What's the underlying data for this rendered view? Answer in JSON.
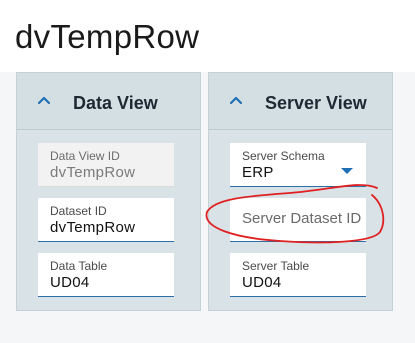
{
  "page": {
    "title": "dvTempRow"
  },
  "left_panel": {
    "title": "Data View",
    "fields": {
      "data_view_id": {
        "label": "Data View ID",
        "value": "dvTempRow"
      },
      "dataset_id": {
        "label": "Dataset ID",
        "value": "dvTempRow"
      },
      "data_table": {
        "label": "Data Table",
        "value": "UD04"
      }
    }
  },
  "right_panel": {
    "title": "Server View",
    "fields": {
      "server_schema": {
        "label": "Server Schema",
        "value": "ERP"
      },
      "server_dataset_id": {
        "placeholder": "Server Dataset ID"
      },
      "server_table": {
        "label": "Server Table",
        "value": "UD04"
      }
    }
  },
  "colors": {
    "accent": "#1f6fb4",
    "annotation": "#e02020"
  },
  "icons": {
    "collapse": "chevron-up-icon",
    "dropdown": "dropdown-arrow-icon"
  }
}
